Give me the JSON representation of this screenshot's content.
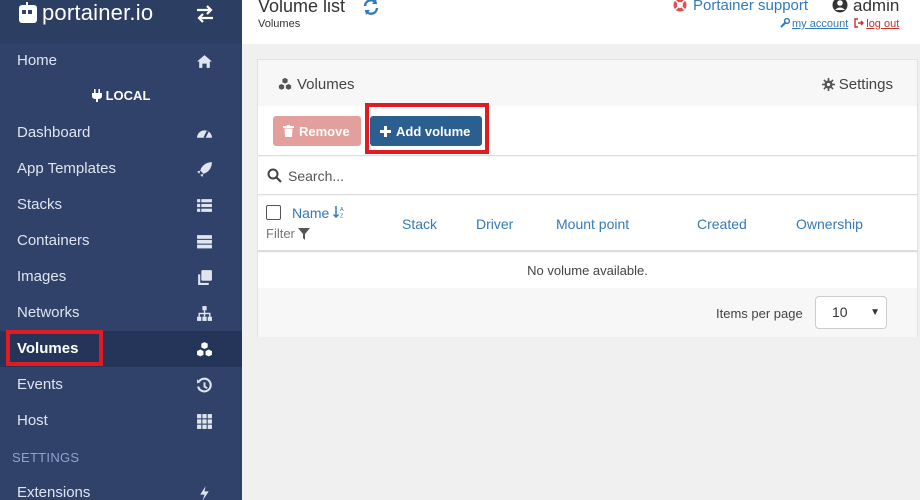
{
  "brand": {
    "name": "portainer.io"
  },
  "sidebar": {
    "endpoint": "LOCAL",
    "section_settings": "SETTINGS",
    "items": [
      {
        "label": "Home",
        "icon": "home-icon"
      },
      {
        "label": "Dashboard",
        "icon": "tachometer-icon"
      },
      {
        "label": "App Templates",
        "icon": "rocket-icon"
      },
      {
        "label": "Stacks",
        "icon": "list-icon"
      },
      {
        "label": "Containers",
        "icon": "server-icon"
      },
      {
        "label": "Images",
        "icon": "clone-icon"
      },
      {
        "label": "Networks",
        "icon": "sitemap-icon"
      },
      {
        "label": "Volumes",
        "icon": "cubes-icon"
      },
      {
        "label": "Events",
        "icon": "history-icon"
      },
      {
        "label": "Host",
        "icon": "grid-icon"
      },
      {
        "label": "Extensions",
        "icon": "bolt-icon"
      }
    ],
    "active": "Volumes"
  },
  "header": {
    "title": "Volume list",
    "breadcrumb": "Volumes",
    "support": "Portainer support",
    "user": "admin",
    "my_account": "my account",
    "log_out": "log out"
  },
  "widget": {
    "title": "Volumes",
    "settings": "Settings",
    "remove_label": "Remove",
    "add_label": "Add volume",
    "search_placeholder": "Search...",
    "columns": [
      "Name",
      "Stack",
      "Driver",
      "Mount point",
      "Created",
      "Ownership"
    ],
    "filter_label": "Filter",
    "empty_message": "No volume available.",
    "items_per_page_label": "Items per page",
    "items_per_page_value": "10"
  },
  "colors": {
    "sidebar_bg": "#30426a",
    "accent": "#337ab7",
    "add_button": "#2a5f8f",
    "remove_button": "#e39f9c",
    "highlight": "#e01b24"
  }
}
